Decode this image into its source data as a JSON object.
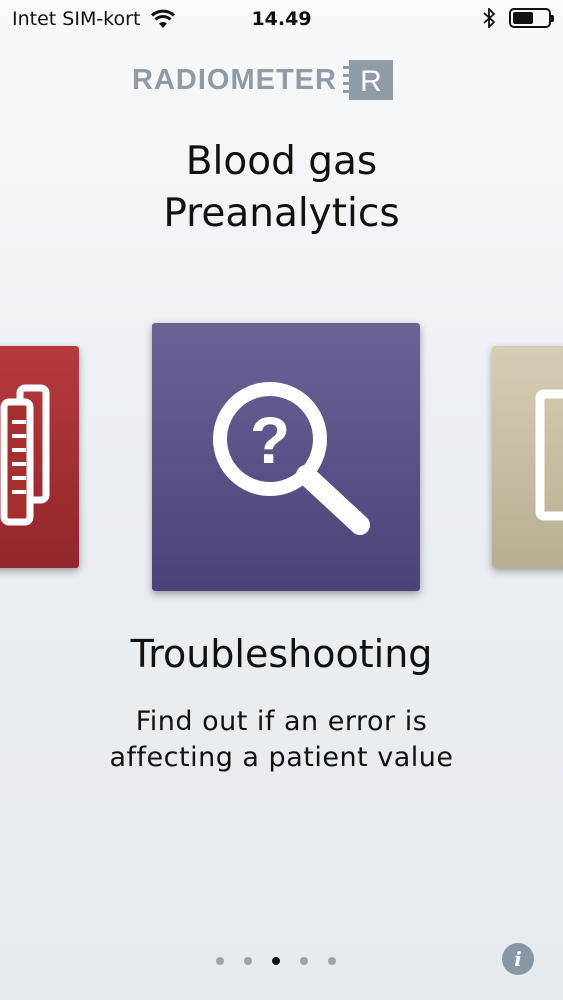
{
  "status_bar": {
    "carrier": "Intet SIM-kort",
    "time": "14.49",
    "battery_level": 0.6
  },
  "brand": {
    "name": "RADIOMETER",
    "logo_letter": "R"
  },
  "app_title": {
    "line1": "Blood gas",
    "line2": "Preanalytics"
  },
  "carousel": {
    "cards": [
      {
        "icon": "documents-icon",
        "color": "#a3302f"
      },
      {
        "icon": "magnifier-question-icon",
        "color": "#5a5386"
      },
      {
        "icon": "frame-icon",
        "color": "#c9bfa4"
      }
    ],
    "active_index": 1
  },
  "feature": {
    "title": "Troubleshooting",
    "description": "Find out if an error is affecting a patient value"
  },
  "pagination": {
    "total": 5,
    "active": 2
  },
  "info_button": {
    "label": "i"
  }
}
